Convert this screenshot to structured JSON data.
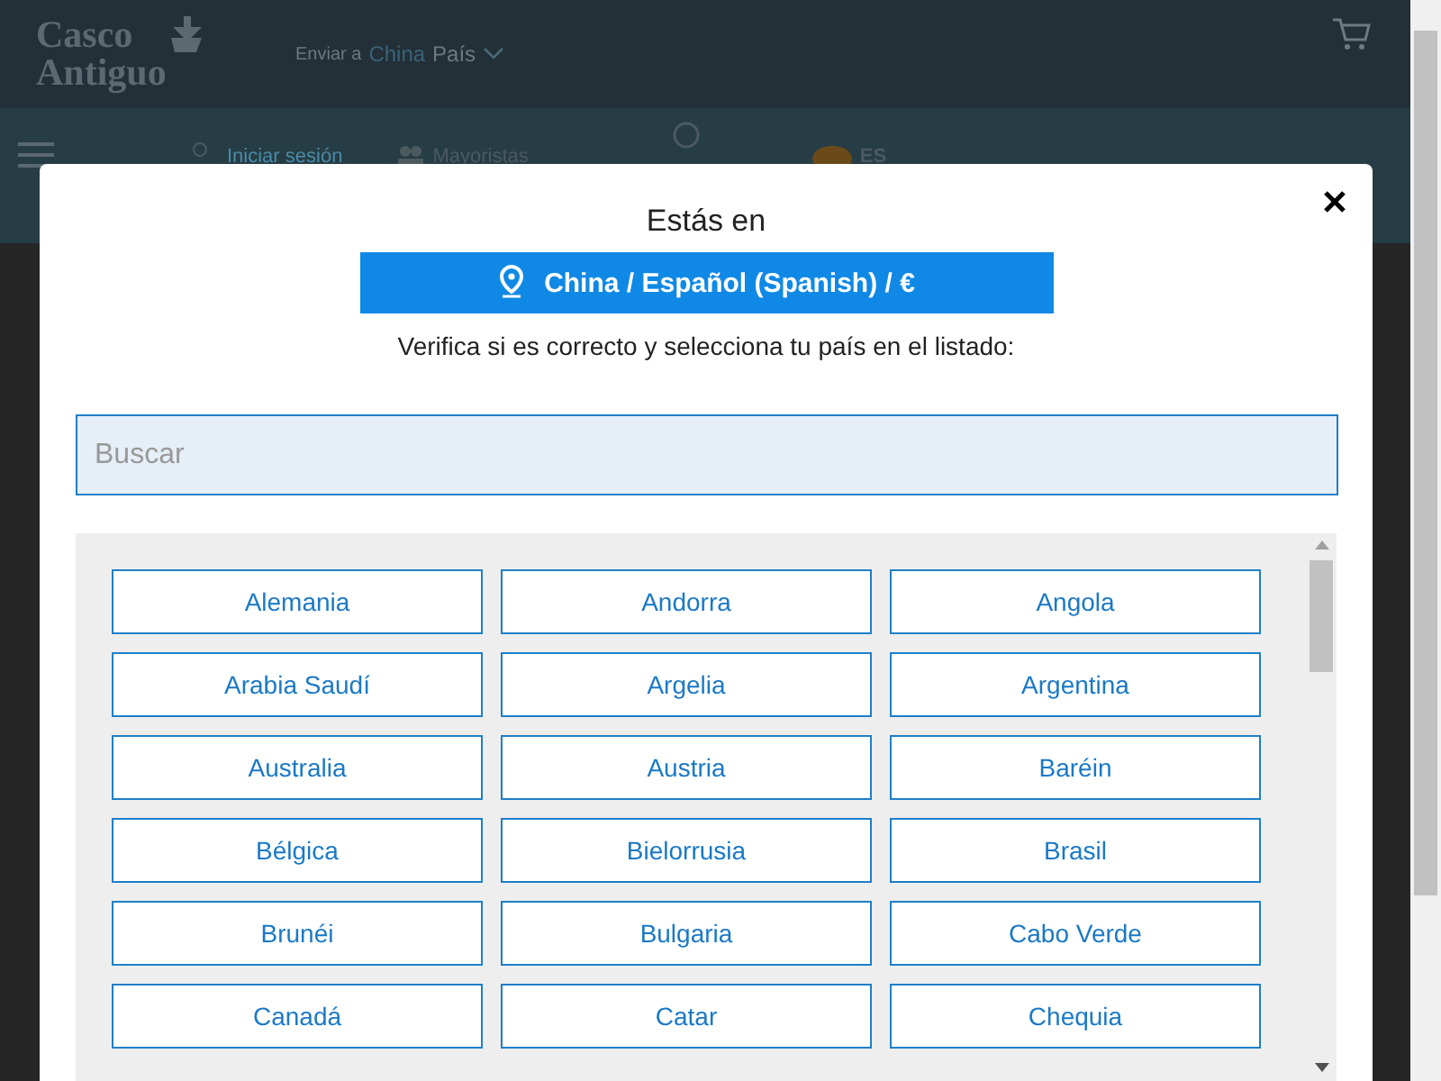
{
  "header": {
    "logo": "Casco Antiguo",
    "ship_prefix": "Enviar a",
    "ship_country": "China",
    "ship_label": "País",
    "nav": {
      "login": "Iniciar sesión",
      "wholesale": "Mayoristas",
      "language": "ES"
    }
  },
  "modal": {
    "title": "Estás en",
    "current": "China / Español (Spanish) / €",
    "instruction": "Verifica si es correcto y selecciona tu país en el listado:",
    "search": {
      "placeholder": "Buscar"
    },
    "countries": [
      "Alemania",
      "Andorra",
      "Angola",
      "Arabia Saudí",
      "Argelia",
      "Argentina",
      "Australia",
      "Austria",
      "Baréin",
      "Bélgica",
      "Bielorrusia",
      "Brasil",
      "Brunéi",
      "Bulgaria",
      "Cabo Verde",
      "Canadá",
      "Catar",
      "Chequia"
    ]
  }
}
